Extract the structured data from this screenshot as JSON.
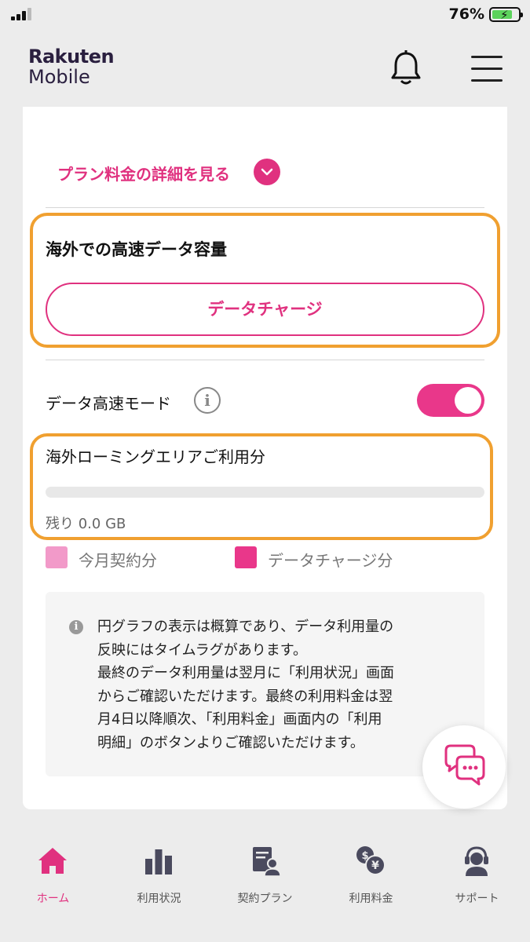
{
  "status": {
    "battery_percent": "76%",
    "battery_level": 0.76
  },
  "header": {
    "logo_brand": "Rakuten",
    "logo_product": "Mobile",
    "icons": [
      "bell-icon",
      "hamburger-menu-icon"
    ]
  },
  "plan": {
    "detail_link": "プラン料金の詳細を見る"
  },
  "overseas": {
    "title": "海外での高速データ容量",
    "charge_button": "データチャージ"
  },
  "data_mode": {
    "label": "データ高速モード",
    "info": "i",
    "enabled": true
  },
  "roaming": {
    "label": "海外ローミングエリアご利用分",
    "usage_fraction": 0,
    "remaining": "残り 0.0 GB"
  },
  "legend": [
    {
      "label": "今月契約分",
      "color": "#f29ac9"
    },
    {
      "label": "データチャージ分",
      "color": "#e9378a"
    }
  ],
  "note": {
    "icon": "i",
    "text": "円グラフの表示は概算であり、データ利用量の\n反映にはタイムラグがあります。\n最終のデータ利用量は翌月に「利用状況」画面\nからご確認いただけます。最終の利用料金は翌\n月4日以降順次、「利用料金」画面内の「利用\n明細」のボタンよりご確認いただけます。"
  },
  "chat_icon": "chat-bubbles-icon",
  "nav": {
    "items": [
      {
        "label": "ホーム",
        "icon": "home-icon",
        "active": true
      },
      {
        "label": "利用状況",
        "icon": "bar-chart-icon",
        "active": false
      },
      {
        "label": "契約プラン",
        "icon": "contract-icon",
        "active": false
      },
      {
        "label": "利用料金",
        "icon": "currency-icon",
        "active": false
      },
      {
        "label": "サポート",
        "icon": "support-icon",
        "active": false
      }
    ]
  },
  "colors": {
    "accent": "#e0317f",
    "toggle_on": "#e9378a",
    "highlight_border": "#f0a030",
    "background": "#ececec"
  }
}
